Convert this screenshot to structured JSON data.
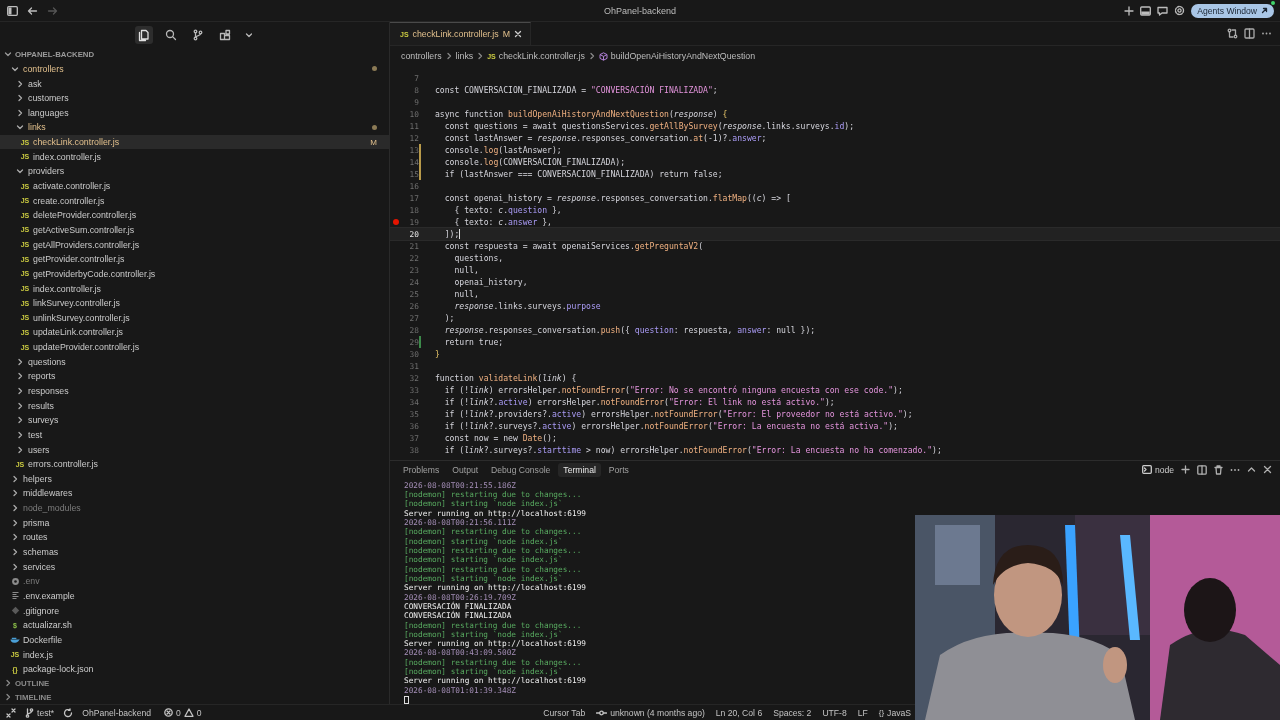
{
  "window": {
    "title": "OhPanel-backend",
    "back_disabled": false,
    "forward_disabled": true,
    "agents_button": "Agents Window"
  },
  "activity_views": [
    {
      "kind": "files",
      "selected": true
    },
    {
      "kind": "search",
      "selected": false
    },
    {
      "kind": "source-control",
      "selected": false
    },
    {
      "kind": "extensions",
      "selected": false
    }
  ],
  "explorer": {
    "title": "OHPANEL-BACKEND",
    "expanded": true,
    "tree": [
      {
        "name": "controllers",
        "kind": "folder",
        "expanded": true,
        "selected": false,
        "modified": true,
        "ignored": false,
        "children": [
          {
            "name": "ask",
            "kind": "folder",
            "expanded": false,
            "selected": false,
            "modified": false,
            "ignored": false
          },
          {
            "name": "customers",
            "kind": "folder",
            "expanded": false,
            "selected": false,
            "modified": false,
            "ignored": false
          },
          {
            "name": "languages",
            "kind": "folder",
            "expanded": false,
            "selected": false,
            "modified": false,
            "ignored": false
          },
          {
            "name": "links",
            "kind": "folder",
            "expanded": true,
            "selected": false,
            "modified": true,
            "ignored": false,
            "children": [
              {
                "name": "checkLink.controller.js",
                "kind": "js",
                "glyph": "JS",
                "selected": true,
                "modified": true,
                "ignored": false,
                "badge": "M"
              },
              {
                "name": "index.controller.js",
                "kind": "js",
                "glyph": "JS",
                "selected": false,
                "modified": false,
                "ignored": false
              }
            ]
          },
          {
            "name": "providers",
            "kind": "folder",
            "expanded": true,
            "selected": false,
            "modified": false,
            "ignored": false,
            "children": [
              {
                "name": "activate.controller.js",
                "kind": "js",
                "glyph": "JS",
                "selected": false,
                "modified": false,
                "ignored": false
              },
              {
                "name": "create.controller.js",
                "kind": "js",
                "glyph": "JS",
                "selected": false,
                "modified": false,
                "ignored": false
              },
              {
                "name": "deleteProvider.controller.js",
                "kind": "js",
                "glyph": "JS",
                "selected": false,
                "modified": false,
                "ignored": false
              },
              {
                "name": "getActiveSum.controller.js",
                "kind": "js",
                "glyph": "JS",
                "selected": false,
                "modified": false,
                "ignored": false
              },
              {
                "name": "getAllProviders.controller.js",
                "kind": "js",
                "glyph": "JS",
                "selected": false,
                "modified": false,
                "ignored": false
              },
              {
                "name": "getProvider.controller.js",
                "kind": "js",
                "glyph": "JS",
                "selected": false,
                "modified": false,
                "ignored": false
              },
              {
                "name": "getProviderbyCode.controller.js",
                "kind": "js",
                "glyph": "JS",
                "selected": false,
                "modified": false,
                "ignored": false
              },
              {
                "name": "index.controller.js",
                "kind": "js",
                "glyph": "JS",
                "selected": false,
                "modified": false,
                "ignored": false
              },
              {
                "name": "linkSurvey.controller.js",
                "kind": "js",
                "glyph": "JS",
                "selected": false,
                "modified": false,
                "ignored": false
              },
              {
                "name": "unlinkSurvey.controller.js",
                "kind": "js",
                "glyph": "JS",
                "selected": false,
                "modified": false,
                "ignored": false
              },
              {
                "name": "updateLink.controller.js",
                "kind": "js",
                "glyph": "JS",
                "selected": false,
                "modified": false,
                "ignored": false
              },
              {
                "name": "updateProvider.controller.js",
                "kind": "js",
                "glyph": "JS",
                "selected": false,
                "modified": false,
                "ignored": false
              }
            ]
          },
          {
            "name": "questions",
            "kind": "folder",
            "expanded": false,
            "selected": false,
            "modified": false,
            "ignored": false
          },
          {
            "name": "reports",
            "kind": "folder",
            "expanded": false,
            "selected": false,
            "modified": false,
            "ignored": false
          },
          {
            "name": "responses",
            "kind": "folder",
            "expanded": false,
            "selected": false,
            "modified": false,
            "ignored": false
          },
          {
            "name": "results",
            "kind": "folder",
            "expanded": false,
            "selected": false,
            "modified": false,
            "ignored": false
          },
          {
            "name": "surveys",
            "kind": "folder",
            "expanded": false,
            "selected": false,
            "modified": false,
            "ignored": false
          },
          {
            "name": "test",
            "kind": "folder",
            "expanded": false,
            "selected": false,
            "modified": false,
            "ignored": false
          },
          {
            "name": "users",
            "kind": "folder",
            "expanded": false,
            "selected": false,
            "modified": false,
            "ignored": false
          },
          {
            "name": "errors.controller.js",
            "kind": "js",
            "glyph": "JS",
            "selected": false,
            "modified": false,
            "ignored": false
          }
        ]
      },
      {
        "name": "helpers",
        "kind": "folder",
        "expanded": false,
        "selected": false,
        "modified": false,
        "ignored": false
      },
      {
        "name": "middlewares",
        "kind": "folder",
        "expanded": false,
        "selected": false,
        "modified": false,
        "ignored": false
      },
      {
        "name": "node_modules",
        "kind": "folder",
        "expanded": false,
        "selected": false,
        "modified": false,
        "ignored": true
      },
      {
        "name": "prisma",
        "kind": "folder",
        "expanded": false,
        "selected": false,
        "modified": false,
        "ignored": false
      },
      {
        "name": "routes",
        "kind": "folder",
        "expanded": false,
        "selected": false,
        "modified": false,
        "ignored": false
      },
      {
        "name": "schemas",
        "kind": "folder",
        "expanded": false,
        "selected": false,
        "modified": false,
        "ignored": false
      },
      {
        "name": "services",
        "kind": "folder",
        "expanded": false,
        "selected": false,
        "modified": false,
        "ignored": false
      },
      {
        "name": ".env",
        "kind": "env",
        "selected": false,
        "modified": false,
        "ignored": true
      },
      {
        "name": ".env.example",
        "kind": "text",
        "selected": false,
        "modified": false,
        "ignored": false
      },
      {
        "name": ".gitignore",
        "kind": "git",
        "selected": false,
        "modified": false,
        "ignored": false
      },
      {
        "name": "actualizar.sh",
        "kind": "sh",
        "glyph": "$",
        "selected": false,
        "modified": false,
        "ignored": false
      },
      {
        "name": "Dockerfile",
        "kind": "docker",
        "selected": false,
        "modified": false,
        "ignored": false
      },
      {
        "name": "index.js",
        "kind": "js",
        "glyph": "JS",
        "selected": false,
        "modified": false,
        "ignored": false
      },
      {
        "name": "package-lock.json",
        "kind": "json",
        "glyph": "{}",
        "selected": false,
        "modified": false,
        "ignored": false
      }
    ]
  },
  "sections": [
    {
      "label": "OUTLINE",
      "expanded": false
    },
    {
      "label": "TIMELINE",
      "expanded": false
    }
  ],
  "editor_tabs": [
    {
      "label": "checkLink.controller.js",
      "glyph": "JS",
      "badge": "M",
      "selected": true,
      "modified": true
    }
  ],
  "breadcrumbs": [
    {
      "label": "controllers",
      "kind": "folder"
    },
    {
      "label": "links",
      "kind": "folder"
    },
    {
      "label": "checkLink.controller.js",
      "kind": "file",
      "glyph": "JS"
    },
    {
      "label": "buildOpenAiHistoryAndNextQuestion",
      "kind": "symbol"
    }
  ],
  "code_lines": [
    {
      "number": "7",
      "current": false,
      "breakpoint": false
    },
    {
      "number": "8",
      "current": false,
      "breakpoint": false,
      "tokens": [
        {
          "kind": "plain",
          "text": "const CONVERSACION_FINALIZADA = "
        },
        {
          "kind": "string",
          "text": "\"CONVERSACIÓN FINALIZADA\""
        },
        {
          "kind": "plain",
          "text": ";"
        }
      ]
    },
    {
      "number": "9",
      "current": false,
      "breakpoint": false
    },
    {
      "number": "10",
      "current": false,
      "breakpoint": false,
      "tokens": [
        {
          "kind": "plain",
          "text": "async function "
        },
        {
          "kind": "func",
          "text": "buildOpenAiHistoryAndNextQuestion"
        },
        {
          "kind": "plain",
          "text": "("
        },
        {
          "kind": "param",
          "text": "response"
        },
        {
          "kind": "plain",
          "text": ") "
        },
        {
          "kind": "bracket",
          "text": "{"
        }
      ]
    },
    {
      "number": "11",
      "current": false,
      "breakpoint": false,
      "tokens": [
        {
          "kind": "plain",
          "text": "  const questions = await questionsServices."
        },
        {
          "kind": "func",
          "text": "getAllBySurvey"
        },
        {
          "kind": "plain",
          "text": "("
        },
        {
          "kind": "param",
          "text": "response"
        },
        {
          "kind": "plain",
          "text": ".links.surveys."
        },
        {
          "kind": "prop",
          "text": "id"
        },
        {
          "kind": "plain",
          "text": ");"
        }
      ]
    },
    {
      "number": "12",
      "current": false,
      "breakpoint": false,
      "tokens": [
        {
          "kind": "plain",
          "text": "  const lastAnswer = "
        },
        {
          "kind": "param",
          "text": "response"
        },
        {
          "kind": "plain",
          "text": ".responses_conversation."
        },
        {
          "kind": "func",
          "text": "at"
        },
        {
          "kind": "plain",
          "text": "(-1)?."
        },
        {
          "kind": "prop",
          "text": "answer"
        },
        {
          "kind": "plain",
          "text": ";"
        }
      ]
    },
    {
      "number": "13",
      "current": false,
      "breakpoint": false,
      "gutter": {
        "kind": "modified"
      },
      "tokens": [
        {
          "kind": "plain",
          "text": "  console."
        },
        {
          "kind": "func",
          "text": "log"
        },
        {
          "kind": "plain",
          "text": "(lastAnswer);"
        }
      ]
    },
    {
      "number": "14",
      "current": false,
      "breakpoint": false,
      "gutter": {
        "kind": "modified"
      },
      "tokens": [
        {
          "kind": "plain",
          "text": "  console."
        },
        {
          "kind": "func",
          "text": "log"
        },
        {
          "kind": "plain",
          "text": "(CONVERSACION_FINALIZADA);"
        }
      ]
    },
    {
      "number": "15",
      "current": false,
      "breakpoint": false,
      "gutter": {
        "kind": "modified"
      },
      "tokens": [
        {
          "kind": "plain",
          "text": "  if (lastAnswer === CONVERSACION_FINALIZADA) return false;"
        }
      ]
    },
    {
      "number": "16",
      "current": false,
      "breakpoint": false
    },
    {
      "number": "17",
      "current": false,
      "breakpoint": false,
      "tokens": [
        {
          "kind": "plain",
          "text": "  const openai_history = "
        },
        {
          "kind": "param",
          "text": "response"
        },
        {
          "kind": "plain",
          "text": ".responses_conversation."
        },
        {
          "kind": "func",
          "text": "flatMap"
        },
        {
          "kind": "plain",
          "text": "(("
        },
        {
          "kind": "param",
          "text": "c"
        },
        {
          "kind": "plain",
          "text": ") => ["
        }
      ]
    },
    {
      "number": "18",
      "current": false,
      "breakpoint": false,
      "tokens": [
        {
          "kind": "plain",
          "text": "    { texto: "
        },
        {
          "kind": "param",
          "text": "c"
        },
        {
          "kind": "plain",
          "text": "."
        },
        {
          "kind": "prop",
          "text": "question"
        },
        {
          "kind": "plain",
          "text": " },"
        }
      ]
    },
    {
      "number": "19",
      "current": false,
      "breakpoint": true,
      "tokens": [
        {
          "kind": "plain",
          "text": "    { texto: "
        },
        {
          "kind": "param",
          "text": "c"
        },
        {
          "kind": "plain",
          "text": "."
        },
        {
          "kind": "prop",
          "text": "answer"
        },
        {
          "kind": "plain",
          "text": " },"
        }
      ]
    },
    {
      "number": "20",
      "current": true,
      "breakpoint": false,
      "tokens": [
        {
          "kind": "plain",
          "text": "  ]);"
        }
      ]
    },
    {
      "number": "21",
      "current": false,
      "breakpoint": false,
      "tokens": [
        {
          "kind": "plain",
          "text": "  const respuesta = await openaiServices."
        },
        {
          "kind": "func",
          "text": "getPreguntaV2"
        },
        {
          "kind": "plain",
          "text": "("
        }
      ]
    },
    {
      "number": "22",
      "current": false,
      "breakpoint": false,
      "tokens": [
        {
          "kind": "plain",
          "text": "    questions,"
        }
      ]
    },
    {
      "number": "23",
      "current": false,
      "breakpoint": false,
      "tokens": [
        {
          "kind": "plain",
          "text": "    null,"
        }
      ]
    },
    {
      "number": "24",
      "current": false,
      "breakpoint": false,
      "tokens": [
        {
          "kind": "plain",
          "text": "    openai_history,"
        }
      ]
    },
    {
      "number": "25",
      "current": false,
      "breakpoint": false,
      "tokens": [
        {
          "kind": "plain",
          "text": "    null,"
        }
      ]
    },
    {
      "number": "26",
      "current": false,
      "breakpoint": false,
      "tokens": [
        {
          "kind": "param",
          "text": "    response"
        },
        {
          "kind": "plain",
          "text": ".links.surveys."
        },
        {
          "kind": "prop",
          "text": "purpose"
        }
      ]
    },
    {
      "number": "27",
      "current": false,
      "breakpoint": false,
      "tokens": [
        {
          "kind": "plain",
          "text": "  );"
        }
      ]
    },
    {
      "number": "28",
      "current": false,
      "breakpoint": false,
      "tokens": [
        {
          "kind": "param",
          "text": "  response"
        },
        {
          "kind": "plain",
          "text": ".responses_conversation."
        },
        {
          "kind": "func",
          "text": "push"
        },
        {
          "kind": "plain",
          "text": "({ "
        },
        {
          "kind": "prop",
          "text": "question"
        },
        {
          "kind": "plain",
          "text": ": respuesta, "
        },
        {
          "kind": "prop",
          "text": "answer"
        },
        {
          "kind": "plain",
          "text": ": null });"
        }
      ]
    },
    {
      "number": "29",
      "current": false,
      "breakpoint": false,
      "gutter": {
        "kind": "added"
      },
      "tokens": [
        {
          "kind": "plain",
          "text": "  return true;"
        }
      ]
    },
    {
      "number": "30",
      "current": false,
      "breakpoint": false,
      "tokens": [
        {
          "kind": "bracket",
          "text": "}"
        }
      ]
    },
    {
      "number": "31",
      "current": false,
      "breakpoint": false
    },
    {
      "number": "32",
      "current": false,
      "breakpoint": false,
      "tokens": [
        {
          "kind": "plain",
          "text": "function "
        },
        {
          "kind": "func",
          "text": "validateLink"
        },
        {
          "kind": "plain",
          "text": "("
        },
        {
          "kind": "param",
          "text": "link"
        },
        {
          "kind": "plain",
          "text": ") {"
        }
      ]
    },
    {
      "number": "33",
      "current": false,
      "breakpoint": false,
      "tokens": [
        {
          "kind": "plain",
          "text": "  if (!"
        },
        {
          "kind": "param",
          "text": "link"
        },
        {
          "kind": "plain",
          "text": ") errorsHelper."
        },
        {
          "kind": "func",
          "text": "notFoundError"
        },
        {
          "kind": "plain",
          "text": "("
        },
        {
          "kind": "string",
          "text": "\"Error: No se encontró ninguna encuesta con ese code.\""
        },
        {
          "kind": "plain",
          "text": ");"
        }
      ]
    },
    {
      "number": "34",
      "current": false,
      "breakpoint": false,
      "tokens": [
        {
          "kind": "plain",
          "text": "  if (!"
        },
        {
          "kind": "param",
          "text": "link"
        },
        {
          "kind": "plain",
          "text": "?."
        },
        {
          "kind": "prop",
          "text": "active"
        },
        {
          "kind": "plain",
          "text": ") errorsHelper."
        },
        {
          "kind": "func",
          "text": "notFoundError"
        },
        {
          "kind": "plain",
          "text": "("
        },
        {
          "kind": "string",
          "text": "\"Error: El link no está activo.\""
        },
        {
          "kind": "plain",
          "text": ");"
        }
      ]
    },
    {
      "number": "35",
      "current": false,
      "breakpoint": false,
      "tokens": [
        {
          "kind": "plain",
          "text": "  if (!"
        },
        {
          "kind": "param",
          "text": "link"
        },
        {
          "kind": "plain",
          "text": "?.providers?."
        },
        {
          "kind": "prop",
          "text": "active"
        },
        {
          "kind": "plain",
          "text": ") errorsHelper."
        },
        {
          "kind": "func",
          "text": "notFoundError"
        },
        {
          "kind": "plain",
          "text": "("
        },
        {
          "kind": "string",
          "text": "\"Error: El proveedor no está activo.\""
        },
        {
          "kind": "plain",
          "text": ");"
        }
      ]
    },
    {
      "number": "36",
      "current": false,
      "breakpoint": false,
      "tokens": [
        {
          "kind": "plain",
          "text": "  if (!"
        },
        {
          "kind": "param",
          "text": "link"
        },
        {
          "kind": "plain",
          "text": "?.surveys?."
        },
        {
          "kind": "prop",
          "text": "active"
        },
        {
          "kind": "plain",
          "text": ") errorsHelper."
        },
        {
          "kind": "func",
          "text": "notFoundError"
        },
        {
          "kind": "plain",
          "text": "("
        },
        {
          "kind": "string",
          "text": "\"Error: La encuesta no está activa.\""
        },
        {
          "kind": "plain",
          "text": ");"
        }
      ]
    },
    {
      "number": "37",
      "current": false,
      "breakpoint": false,
      "tokens": [
        {
          "kind": "plain",
          "text": "  const now = new "
        },
        {
          "kind": "func",
          "text": "Date"
        },
        {
          "kind": "plain",
          "text": "();"
        }
      ]
    },
    {
      "number": "38",
      "current": false,
      "breakpoint": false,
      "tokens": [
        {
          "kind": "plain",
          "text": "  if ("
        },
        {
          "kind": "param",
          "text": "link"
        },
        {
          "kind": "plain",
          "text": "?.surveys?."
        },
        {
          "kind": "prop",
          "text": "starttime"
        },
        {
          "kind": "plain",
          "text": " > now) errorsHelper."
        },
        {
          "kind": "func",
          "text": "notFoundError"
        },
        {
          "kind": "plain",
          "text": "("
        },
        {
          "kind": "string",
          "text": "\"Error: La encuesta no ha comenzado.\""
        },
        {
          "kind": "plain",
          "text": ");"
        }
      ]
    }
  ],
  "panel_tabs": [
    {
      "label": "Problems",
      "selected": false
    },
    {
      "label": "Output",
      "selected": false
    },
    {
      "label": "Debug Console",
      "selected": false
    },
    {
      "label": "Terminal",
      "selected": true
    },
    {
      "label": "Ports",
      "selected": false
    }
  ],
  "terminal": {
    "shell": "node",
    "lines": [
      {
        "kind": "timestamp",
        "text": "2026-08-08T00:21:55.186Z"
      },
      {
        "kind": "nodemon",
        "text": "[nodemon] restarting due to changes..."
      },
      {
        "kind": "nodemon",
        "text": "[nodemon] starting `node index.js`"
      },
      {
        "kind": "output",
        "text": "Server running on http://localhost:6199"
      },
      {
        "kind": "timestamp",
        "text": "2026-08-08T00:21:56.111Z"
      },
      {
        "kind": "nodemon",
        "text": "[nodemon] restarting due to changes..."
      },
      {
        "kind": "nodemon",
        "text": "[nodemon] starting `node index.js`"
      },
      {
        "kind": "nodemon",
        "text": "[nodemon] restarting due to changes..."
      },
      {
        "kind": "nodemon",
        "text": "[nodemon] starting `node index.js`"
      },
      {
        "kind": "nodemon",
        "text": "[nodemon] restarting due to changes..."
      },
      {
        "kind": "nodemon",
        "text": "[nodemon] starting `node index.js`"
      },
      {
        "kind": "output",
        "text": "Server running on http://localhost:6199"
      },
      {
        "kind": "timestamp",
        "text": "2026-08-08T00:26:19.709Z"
      },
      {
        "kind": "output",
        "text": "CONVERSACIÓN FINALIZADA"
      },
      {
        "kind": "output",
        "text": "CONVERSACIÓN FINALIZADA"
      },
      {
        "kind": "nodemon",
        "text": "[nodemon] restarting due to changes..."
      },
      {
        "kind": "nodemon",
        "text": "[nodemon] starting `node index.js`"
      },
      {
        "kind": "output",
        "text": "Server running on http://localhost:6199"
      },
      {
        "kind": "timestamp",
        "text": "2026-08-08T00:43:09.500Z"
      },
      {
        "kind": "nodemon",
        "text": "[nodemon] restarting due to changes..."
      },
      {
        "kind": "nodemon",
        "text": "[nodemon] starting `node index.js`"
      },
      {
        "kind": "output",
        "text": "Server running on http://localhost:6199"
      },
      {
        "kind": "timestamp",
        "text": "2026-08-08T01:01:39.348Z"
      }
    ]
  },
  "status_bar": {
    "branch": "test*",
    "project": "OhPanel-backend",
    "errors": "0",
    "warnings": "0",
    "right": [
      {
        "kind": "plain",
        "text": "Cursor Tab"
      },
      {
        "kind": "blame",
        "text": "unknown (4 months ago)"
      },
      {
        "kind": "plain",
        "text": "Ln 20, Col 6"
      },
      {
        "kind": "plain",
        "text": "Spaces: 2"
      },
      {
        "kind": "plain",
        "text": "UTF-8"
      },
      {
        "kind": "plain",
        "text": "LF"
      },
      {
        "kind": "language",
        "glyph": "{}",
        "text": "JavaS"
      }
    ]
  }
}
